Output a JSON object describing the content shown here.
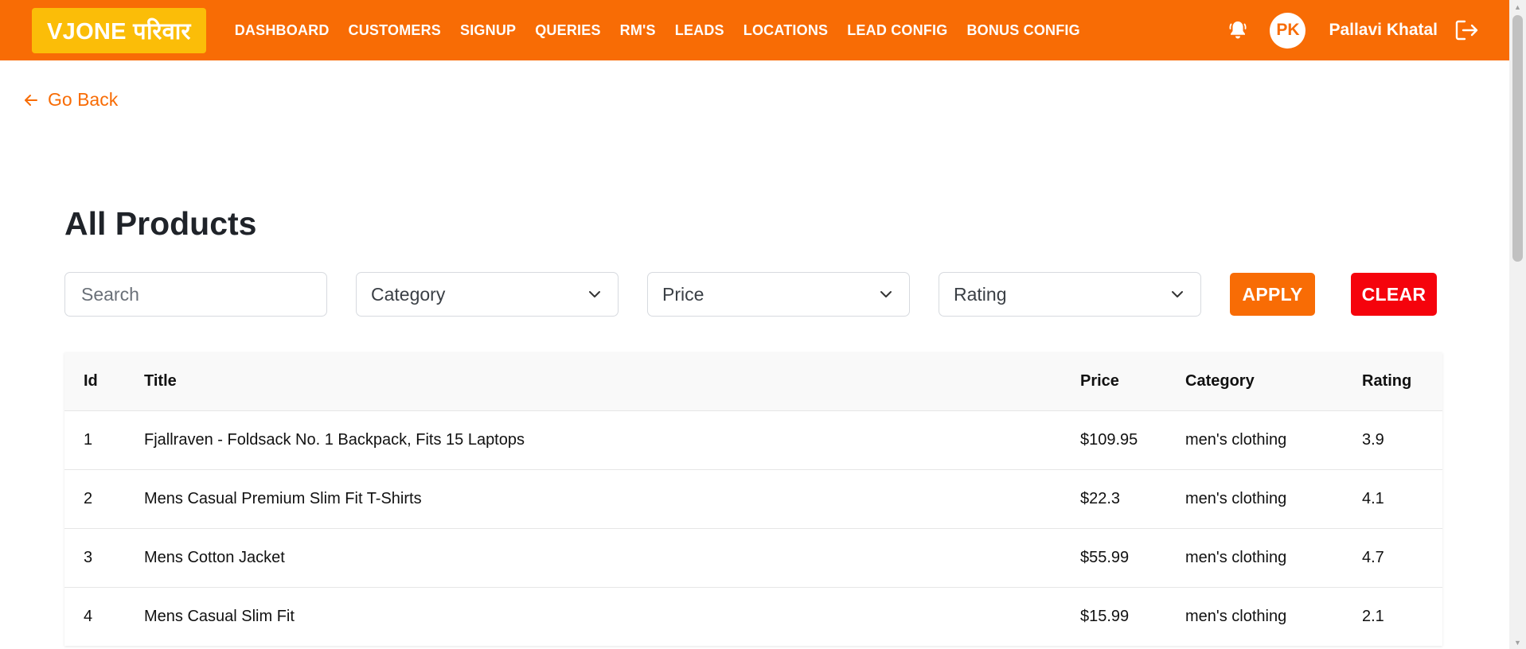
{
  "brand": {
    "logo_text": "VJONE परिवार",
    "primary_color": "#f86c05",
    "logo_color": "#fbbd08",
    "danger_color": "#f5030c"
  },
  "nav": {
    "links": [
      {
        "label": "DASHBOARD"
      },
      {
        "label": "CUSTOMERS"
      },
      {
        "label": "SIGNUP"
      },
      {
        "label": "QUERIES"
      },
      {
        "label": "RM'S"
      },
      {
        "label": "LEADS"
      },
      {
        "label": "LOCATIONS"
      },
      {
        "label": "LEAD CONFIG"
      },
      {
        "label": "BONUS CONFIG"
      }
    ],
    "notification_icon": "bell-icon",
    "user": {
      "initials": "PK",
      "name": "Pallavi Khatal"
    },
    "logout_icon": "logout-icon"
  },
  "go_back": {
    "label": "Go Back",
    "icon": "arrow-left-icon"
  },
  "page": {
    "title": "All Products"
  },
  "filters": {
    "search_placeholder": "Search",
    "category_label": "Category",
    "price_label": "Price",
    "rating_label": "Rating",
    "apply_label": "APPLY",
    "clear_label": "CLEAR"
  },
  "table": {
    "headers": {
      "id": "Id",
      "title": "Title",
      "price": "Price",
      "category": "Category",
      "rating": "Rating"
    },
    "rows": [
      {
        "id": "1",
        "title": "Fjallraven - Foldsack No. 1 Backpack, Fits 15 Laptops",
        "price": "$109.95",
        "category": "men's clothing",
        "rating": "3.9"
      },
      {
        "id": "2",
        "title": "Mens Casual Premium Slim Fit T-Shirts",
        "price": "$22.3",
        "category": "men's clothing",
        "rating": "4.1"
      },
      {
        "id": "3",
        "title": "Mens Cotton Jacket",
        "price": "$55.99",
        "category": "men's clothing",
        "rating": "4.7"
      },
      {
        "id": "4",
        "title": "Mens Casual Slim Fit",
        "price": "$15.99",
        "category": "men's clothing",
        "rating": "2.1"
      }
    ]
  }
}
